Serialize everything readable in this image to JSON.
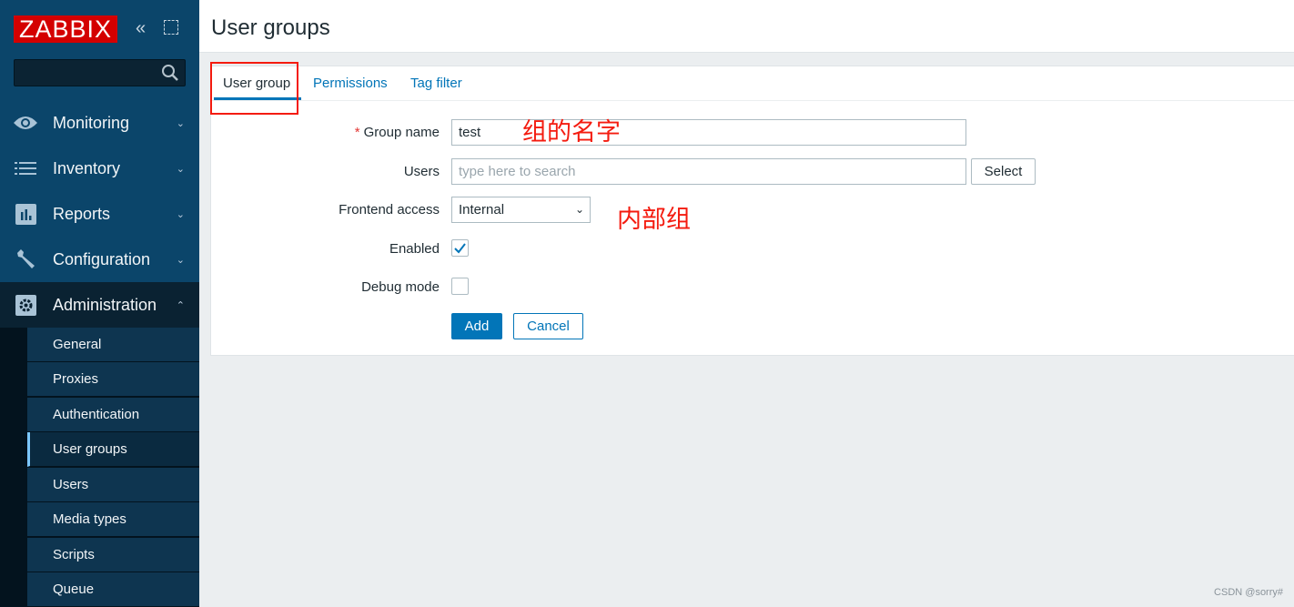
{
  "logo": "ZABBIX",
  "sidebar": {
    "collapse_icon": "double-chevron-left-icon",
    "kiosk_icon": "fullscreen-icon",
    "search_icon": "search-icon",
    "menu": [
      {
        "label": "Monitoring",
        "icon": "eye-icon"
      },
      {
        "label": "Inventory",
        "icon": "list-icon"
      },
      {
        "label": "Reports",
        "icon": "bar-chart-icon"
      },
      {
        "label": "Configuration",
        "icon": "wrench-icon"
      },
      {
        "label": "Administration",
        "icon": "gear-icon",
        "expanded": true
      }
    ],
    "submenu": [
      "General",
      "Proxies",
      "Authentication",
      "User groups",
      "Users",
      "Media types",
      "Scripts",
      "Queue"
    ],
    "selected_submenu": "User groups"
  },
  "page": {
    "title": "User groups"
  },
  "tabs": [
    {
      "label": "User group",
      "active": true
    },
    {
      "label": "Permissions"
    },
    {
      "label": "Tag filter"
    }
  ],
  "form": {
    "group_name": {
      "label": "Group name",
      "required_mark": "*",
      "value": "test"
    },
    "users": {
      "label": "Users",
      "placeholder": "type here to search",
      "select_label": "Select"
    },
    "frontend_access": {
      "label": "Frontend access",
      "value": "Internal"
    },
    "enabled": {
      "label": "Enabled",
      "checked": true
    },
    "debug_mode": {
      "label": "Debug mode",
      "checked": false
    },
    "add_label": "Add",
    "cancel_label": "Cancel"
  },
  "annotations": {
    "group_name_note": "组的名字",
    "frontend_note": "内部组"
  },
  "watermark": "CSDN @sorry#",
  "colors": {
    "accent": "#0275b8",
    "sidebar": "#0b456a",
    "annotation": "#f41b0f",
    "logo": "#d40000"
  }
}
